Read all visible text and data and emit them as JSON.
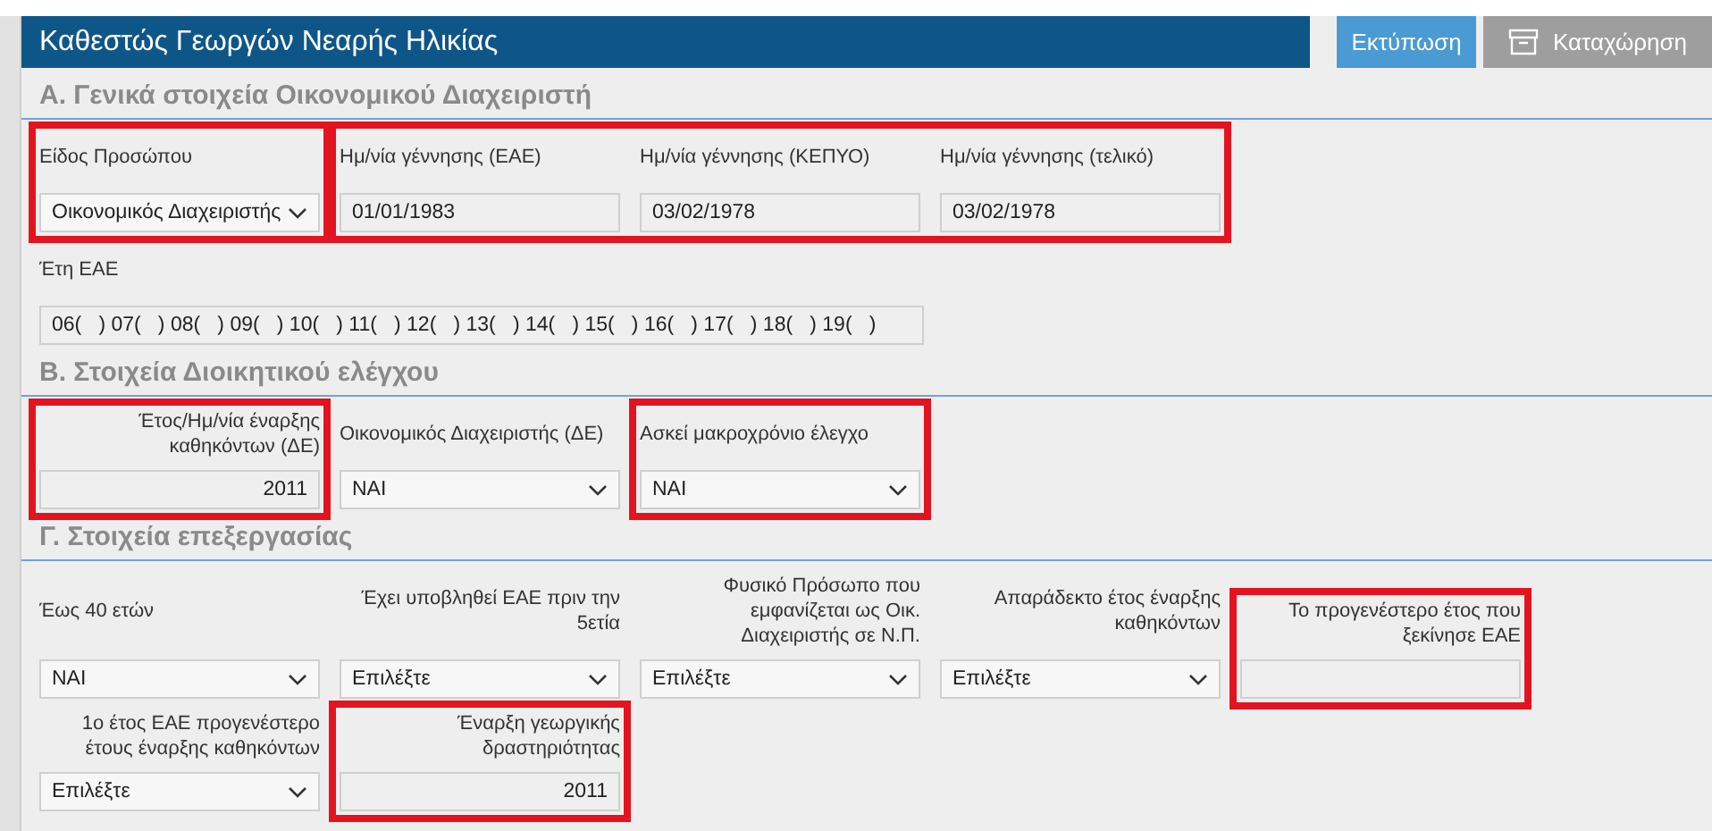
{
  "header": {
    "title": "Καθεστώς Γεωργών Νεαρής Ηλικίας",
    "buttons": [
      {
        "label": "Εκτύπωση",
        "kind": "primary"
      },
      {
        "label": "Καταχώρηση",
        "kind": "archive"
      }
    ]
  },
  "sections": [
    {
      "title": "Α. Γενικά στοιχεία Οικονομικού Διαχειριστή",
      "rows": [
        {
          "groups": [
            {
              "highlighted": true,
              "fields": [
                {
                  "label": "Είδος Προσώπου",
                  "kind": "select",
                  "value": "Οικονομικός Διαχειριστής"
                }
              ]
            },
            {
              "highlighted": true,
              "fields": [
                {
                  "label": "Ημ/νία γέννησης (ΕΑΕ)",
                  "kind": "text",
                  "value": "01/01/1983"
                },
                {
                  "label": "Ημ/νία γέννησης (ΚΕΠΥΟ)",
                  "kind": "text",
                  "value": "03/02/1978"
                },
                {
                  "label": "Ημ/νία γέννησης (τελικό)",
                  "kind": "text",
                  "value": "03/02/1978"
                }
              ]
            }
          ]
        },
        {
          "groups": [
            {
              "highlighted": false,
              "fields": [
                {
                  "label": "Έτη ΕΑΕ",
                  "kind": "wide",
                  "value": "06(   ) 07(   ) 08(   ) 09(   ) 10(   ) 11(   ) 12(   ) 13(   ) 14(   ) 15(   ) 16(   ) 17(   ) 18(   ) 19(   )"
                }
              ]
            }
          ]
        }
      ]
    },
    {
      "title": "Β. Στοιχεία Διοικητικού ελέγχου",
      "rows": [
        {
          "groups": [
            {
              "highlighted": true,
              "fields": [
                {
                  "label": "Έτος/Ημ/νία έναρξης καθηκόντων (ΔΕ)",
                  "kind": "number",
                  "value": "2011"
                }
              ]
            },
            {
              "highlighted": false,
              "fields": [
                {
                  "label": "Οικονομικός Διαχειριστής (ΔΕ)",
                  "kind": "select",
                  "value": "ΝΑΙ"
                }
              ]
            },
            {
              "highlighted": true,
              "fields": [
                {
                  "label": "Ασκεί μακροχρόνιο έλεγχο",
                  "kind": "select",
                  "value": "ΝΑΙ"
                }
              ]
            }
          ]
        }
      ]
    },
    {
      "title": "Γ. Στοιχεία επεξεργασίας",
      "rows": [
        {
          "groups": [
            {
              "highlighted": false,
              "fields": [
                {
                  "label": "Έως 40 ετών",
                  "kind": "select",
                  "value": "ΝΑΙ"
                },
                {
                  "label": "Έχει υποβληθεί ΕΑΕ πριν την 5ετία",
                  "kind": "select",
                  "value": "Επιλέξτε"
                },
                {
                  "label": "Φυσικό Πρόσωπο που εμφανίζεται ως Οικ. Διαχειριστής σε Ν.Π.",
                  "kind": "select",
                  "value": "Επιλέξτε"
                },
                {
                  "label": "Απαράδεκτο έτος έναρξης καθηκόντων",
                  "kind": "select",
                  "value": "Επιλέξτε"
                }
              ]
            },
            {
              "highlighted": true,
              "fields": [
                {
                  "label": "Το προγενέστερο έτος που ξεκίνησε ΕΑΕ",
                  "kind": "number"
                }
              ]
            }
          ]
        },
        {
          "groups": [
            {
              "highlighted": false,
              "fields": [
                {
                  "label": "1ο έτος ΕΑΕ προγενέστερο έτους έναρξης καθηκόντων",
                  "kind": "select",
                  "value": "Επιλέξτε"
                }
              ]
            },
            {
              "highlighted": true,
              "fields": [
                {
                  "label": "Έναρξη γεωργικής δραστηριότητας",
                  "kind": "number",
                  "value": "2011"
                }
              ]
            }
          ]
        }
      ]
    }
  ]
}
